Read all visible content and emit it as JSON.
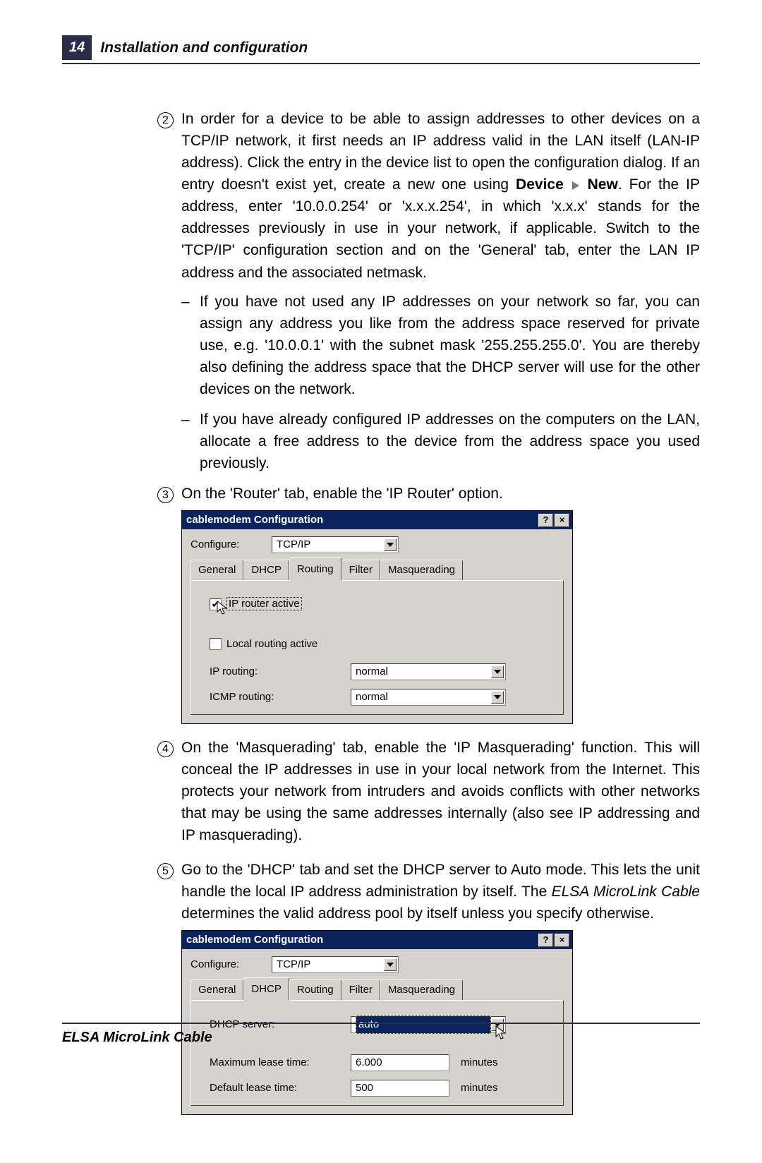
{
  "header": {
    "page_number": "14",
    "title": "Installation and configuration"
  },
  "steps": {
    "s2": {
      "num": "2",
      "text_before": "In order for a device to be able to assign addresses to other devices on a TCP/IP network, it first needs an IP address valid in the LAN itself (LAN-IP address).  Click the entry in the device list to open the configuration dialog.  If an entry doesn't exist yet, create a new one using ",
      "bold1": "Device",
      "bold2": "New",
      "text_after": ".  For the IP address, enter '10.0.0.254' or 'x.x.x.254', in which 'x.x.x' stands for the addresses previously in use in your network, if applicable.   Switch to the 'TCP/IP' configuration section and on the 'General' tab, enter the LAN IP address and the associated netmask."
    },
    "s2_sub1": "If you have not used any IP addresses on your network so far, you can assign any address you like from the address space reserved for private use, e.g. '10.0.0.1' with the subnet mask '255.255.255.0'.  You are thereby also defining the address space that the DHCP server will use for the other devices on the network.",
    "s2_sub2": "If you have already configured IP addresses on the computers on the LAN, allocate a free address to the device from the address space you used previously.",
    "s3": {
      "num": "3",
      "text": "On the 'Router' tab, enable the 'IP Router' option."
    },
    "s4": {
      "num": "4",
      "text": "On the 'Masquerading' tab, enable the 'IP Masquerading' function.  This will conceal the IP addresses in use in your local network from the Internet.  This protects your network from intruders and avoids conflicts with other networks that may be using the same addresses internally (also see IP addressing and IP masquerading)."
    },
    "s5": {
      "num": "5",
      "text_before": "Go to the 'DHCP' tab and set the DHCP server to Auto mode.  This lets the unit handle the local IP address administration by itself.  The ",
      "product": "ELSA MicroLink Cable",
      "text_after": " determines the valid address pool by itself unless you specify otherwise."
    }
  },
  "dialog1": {
    "title": "cablemodem Configuration",
    "configure_label": "Configure:",
    "configure_value": "TCP/IP",
    "tabs": [
      "General",
      "DHCP",
      "Routing",
      "Filter",
      "Masquerading"
    ],
    "active_tab": "Routing",
    "ip_router_active": "IP router active",
    "local_routing_active": "Local routing active",
    "ip_routing_label": "IP routing:",
    "ip_routing_value": "normal",
    "icmp_routing_label": "ICMP routing:",
    "icmp_routing_value": "normal"
  },
  "dialog2": {
    "title": "cablemodem Configuration",
    "configure_label": "Configure:",
    "configure_value": "TCP/IP",
    "tabs": [
      "General",
      "DHCP",
      "Routing",
      "Filter",
      "Masquerading"
    ],
    "active_tab": "DHCP",
    "dhcp_server_label": "DHCP server:",
    "dhcp_server_value": "auto",
    "max_lease_label": "Maximum lease time:",
    "max_lease_value": "6.000",
    "default_lease_label": "Default lease time:",
    "default_lease_value": "500",
    "minutes": "minutes"
  },
  "footer": "ELSA MicroLink Cable"
}
